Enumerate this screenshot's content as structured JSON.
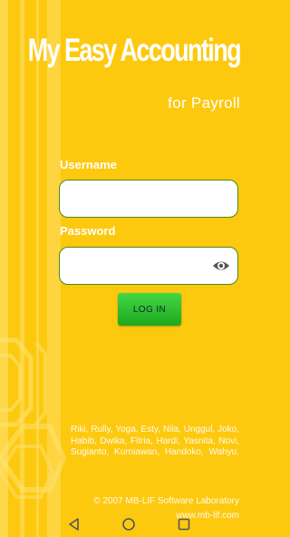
{
  "app": {
    "title": "My Easy Accounting",
    "subtitle": "for Payroll"
  },
  "form": {
    "username_label": "Username",
    "username_value": "",
    "password_label": "Password",
    "password_value": "",
    "login_label": "LOG IN"
  },
  "footer": {
    "credits": "Riki, Rully, Yoga, Esty, Nila, Unggul, Joko, Habib, Dwika, Fitria, Hardi, Yasnita, Novi, Sugianto, Kurniawan, Handoko, Wahyu.",
    "copyright": "© 2007 MB-LIF Software Laboratory",
    "website": "www.mb-lif.com"
  },
  "icons": {
    "password_toggle": "eye-icon",
    "nav_back": "back-triangle-icon",
    "nav_home": "home-circle-icon",
    "nav_recents": "recents-square-icon"
  },
  "colors": {
    "background": "#fdc90f",
    "button": "#2cbf2c",
    "field_border": "#4c8a1a"
  }
}
